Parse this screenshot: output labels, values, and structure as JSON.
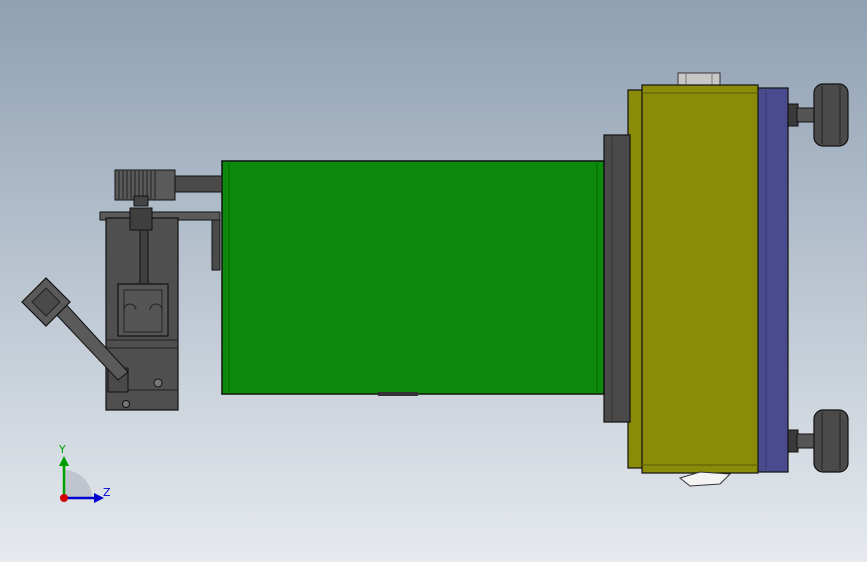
{
  "viewport": {
    "background_top": "#8fa0b3",
    "background_bottom": "#e6eaee"
  },
  "model": {
    "colors": {
      "green_housing": "#0b8a0b",
      "olive_plate": "#8b8b0a",
      "blue_plate": "#4a4a8f",
      "dark_parts": "#4a4a4a",
      "outline": "#1a1a1a"
    },
    "parts": [
      "wheel-top",
      "wheel-bottom",
      "blue-side-plate",
      "olive-end-plate",
      "dark-flange",
      "green-housing",
      "belt-pulley",
      "motor-body",
      "handle-lever"
    ]
  },
  "triad": {
    "y_label": "Y",
    "z_label": "Z",
    "y_color": "#00a000",
    "z_color": "#0000d0",
    "x_color": "#d00000"
  }
}
